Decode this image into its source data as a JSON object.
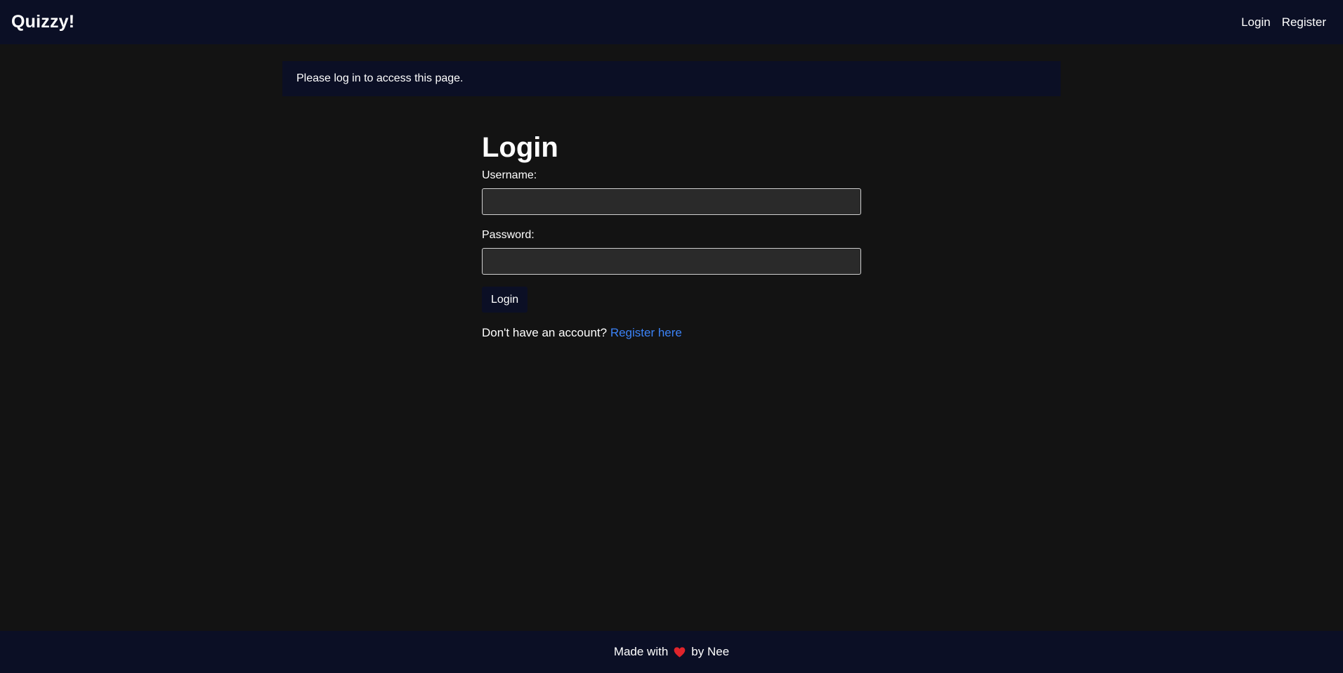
{
  "navbar": {
    "brand": "Quizzy!",
    "links": [
      {
        "label": "Login"
      },
      {
        "label": "Register"
      }
    ]
  },
  "alert": {
    "message": "Please log in to access this page."
  },
  "login_form": {
    "title": "Login",
    "username_label": "Username:",
    "username_value": "",
    "password_label": "Password:",
    "password_value": "",
    "submit_label": "Login",
    "register_prompt": "Don't have an account?",
    "register_link": "Register here"
  },
  "footer": {
    "prefix": "Made with",
    "icon": "heart-icon",
    "suffix": "by Nee"
  },
  "colors": {
    "background": "#131313",
    "bar": "#0b0f25",
    "link": "#3b82f6",
    "heart": "#e0242b"
  }
}
